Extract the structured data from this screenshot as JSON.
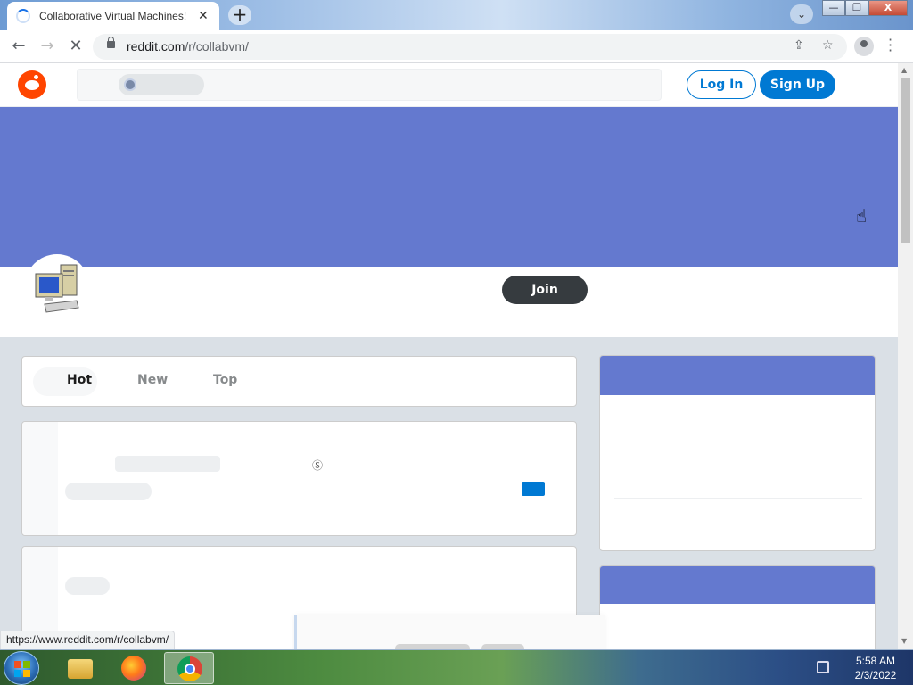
{
  "browser": {
    "tab_title": "Collaborative Virtual Machines!",
    "tab_close": "✕",
    "new_tab": "+",
    "tab_search": "⌄",
    "url_host": "reddit.com",
    "url_path": "/r/collabvm/",
    "status_url": "https://www.reddit.com/r/collabvm/",
    "window_buttons": {
      "minimize": "—",
      "restore": "❐",
      "close": "X"
    },
    "icons": [
      "back-icon",
      "forward-icon",
      "stop-loading-icon",
      "lock-icon",
      "share-icon",
      "star-icon",
      "profile-icon",
      "menu-icon"
    ]
  },
  "reddit": {
    "header": {
      "login": "Log In",
      "signup": "Sign Up"
    },
    "subreddit": {
      "join": "Join"
    },
    "sort": {
      "hot": "Hot",
      "new": "New",
      "top": "Top"
    },
    "colors": {
      "banner": "#6479cf",
      "brand": "#ff4500",
      "accent": "#0079d3"
    }
  },
  "taskbar": {
    "time": "5:58 AM",
    "date": "2/3/2022",
    "apps": [
      "windows-explorer-icon",
      "firefox-icon",
      "chrome-icon"
    ]
  }
}
